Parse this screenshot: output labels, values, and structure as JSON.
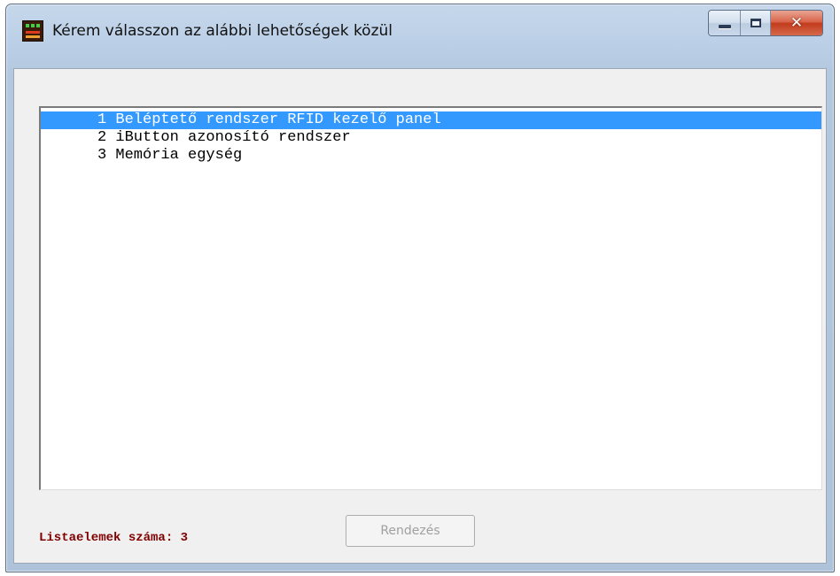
{
  "window": {
    "title": "Kérem válasszon az alábbi lehetőségek közül",
    "icon": "app-icon"
  },
  "titlebar_buttons": {
    "minimize": "minimize-icon",
    "maximize": "maximize-icon",
    "close": "✕"
  },
  "list": {
    "items": [
      "1 Beléptető rendszer RFID kezelő panel",
      "2 iButton azonosító rendszer",
      "3 Memória egység"
    ],
    "selected_index": 0
  },
  "status": {
    "count_label": "Listaelemek száma: 3"
  },
  "buttons": {
    "sort_label": "Rendezés",
    "sort_enabled": false
  },
  "colors": {
    "selection": "#3399ff",
    "status_text": "#800000"
  }
}
